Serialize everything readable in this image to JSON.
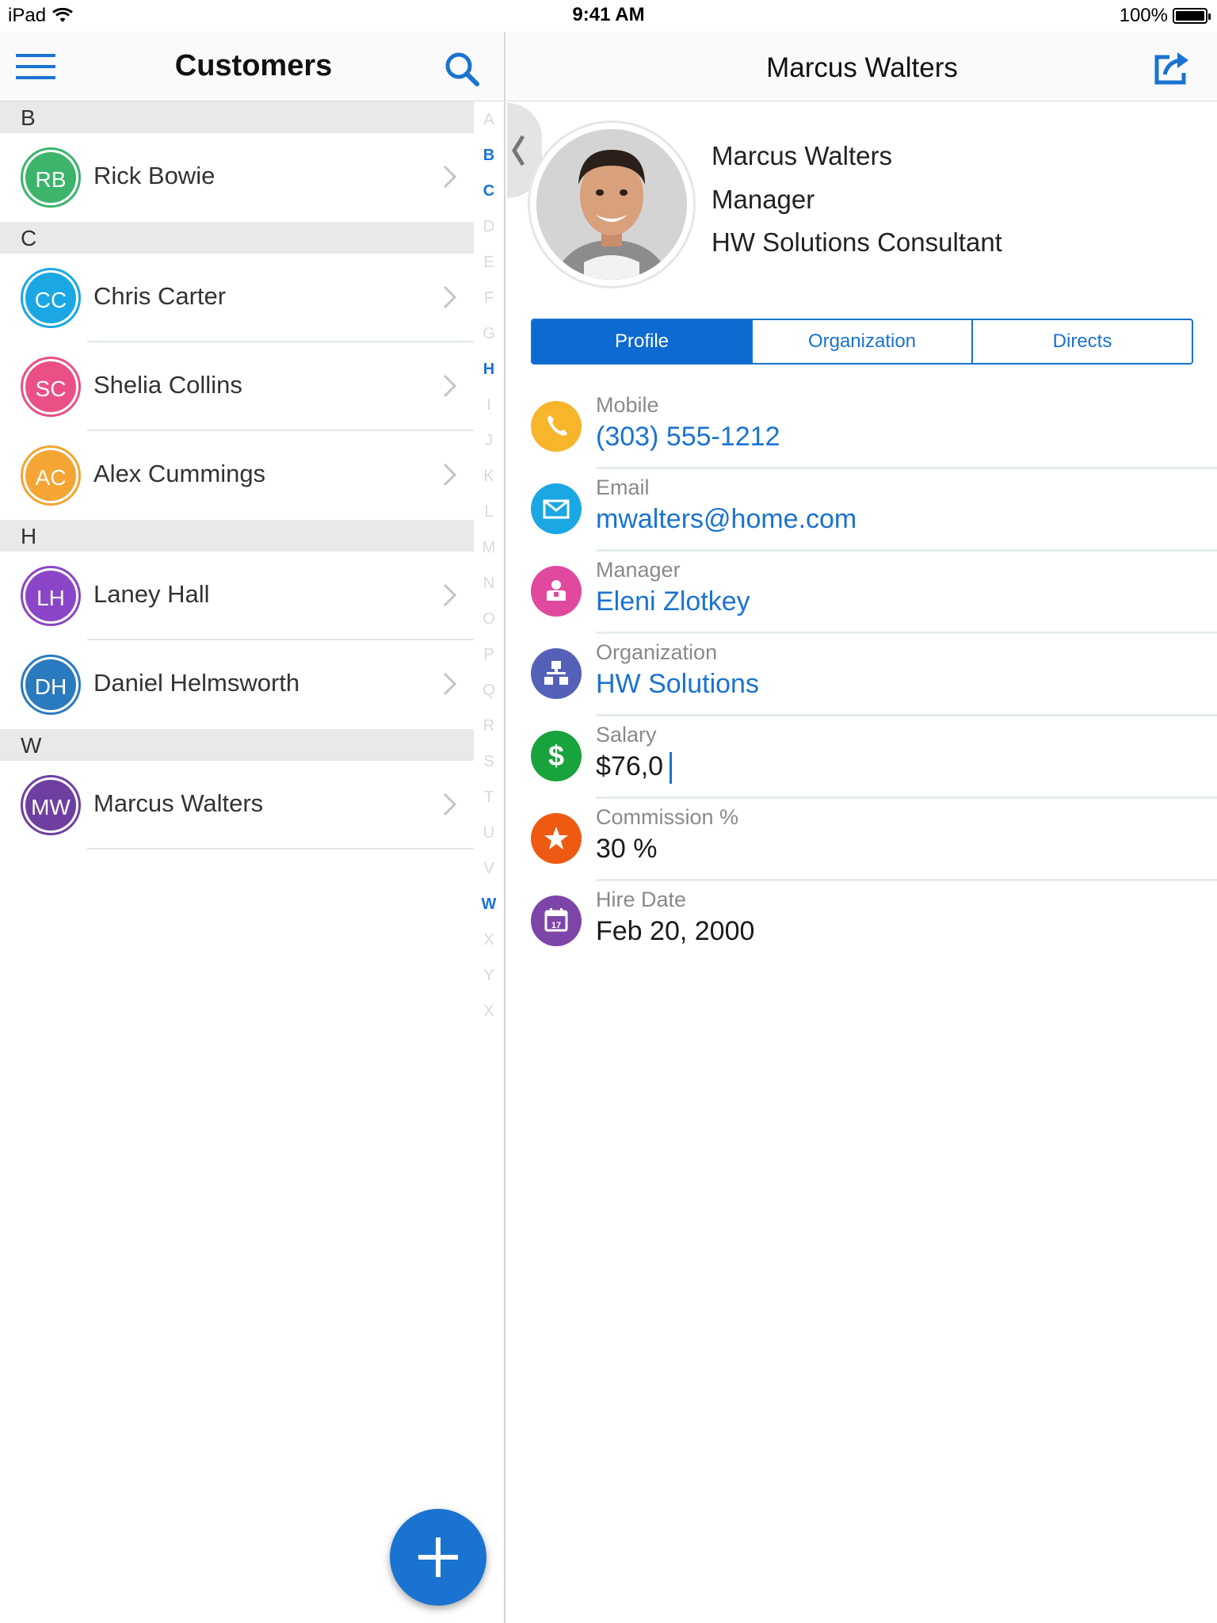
{
  "status_bar": {
    "device": "iPad",
    "time": "9:41 AM",
    "battery": "100%"
  },
  "left_pane": {
    "title": "Customers",
    "sections": [
      {
        "letter": "B",
        "people": [
          {
            "initials": "RB",
            "name": "Rick Bowie",
            "color": "#3cb46b"
          }
        ]
      },
      {
        "letter": "C",
        "people": [
          {
            "initials": "CC",
            "name": "Chris Carter",
            "color": "#1aa7e4"
          },
          {
            "initials": "SC",
            "name": "Shelia Collins",
            "color": "#ea4f86"
          },
          {
            "initials": "AC",
            "name": "Alex Cummings",
            "color": "#f4a533"
          }
        ]
      },
      {
        "letter": "H",
        "people": [
          {
            "initials": "LH",
            "name": "Laney Hall",
            "color": "#8b45c8"
          },
          {
            "initials": "DH",
            "name": "Daniel Helmsworth",
            "color": "#2a7ac0"
          }
        ]
      },
      {
        "letter": "W",
        "people": [
          {
            "initials": "MW",
            "name": "Marcus Walters",
            "color": "#6e3fa0"
          }
        ]
      }
    ],
    "index_letters": [
      "A",
      "B",
      "C",
      "D",
      "E",
      "F",
      "G",
      "H",
      "I",
      "J",
      "K",
      "L",
      "M",
      "N",
      "O",
      "P",
      "Q",
      "R",
      "S",
      "T",
      "U",
      "V",
      "W",
      "X",
      "Y",
      "X"
    ],
    "index_active": [
      "B",
      "C",
      "H",
      "W"
    ]
  },
  "right_pane": {
    "title": "Marcus Walters",
    "person": {
      "name": "Marcus Walters",
      "role": "Manager",
      "position": "HW Solutions Consultant"
    },
    "tabs": [
      "Profile",
      "Organization",
      "Directs"
    ],
    "active_tab": "Profile",
    "fields": [
      {
        "label": "Mobile",
        "value": "(303) 555-1212",
        "link": true,
        "icon": "phone-icon",
        "color": "#f7b52c"
      },
      {
        "label": "Email",
        "value": "mwalters@home.com",
        "link": true,
        "icon": "email-icon",
        "color": "#1aa7e4"
      },
      {
        "label": "Manager",
        "value": "Eleni Zlotkey",
        "link": true,
        "icon": "manager-icon",
        "color": "#e0499e"
      },
      {
        "label": "Organization",
        "value": "HW Solutions",
        "link": true,
        "icon": "organization-icon",
        "color": "#5560b8"
      },
      {
        "label": "Salary",
        "value": "$76,0",
        "link": false,
        "icon": "dollar-icon",
        "color": "#19a33c"
      },
      {
        "label": "Commission %",
        "value": "30 %",
        "link": false,
        "icon": "star-icon",
        "color": "#ef5a13"
      },
      {
        "label": "Hire Date",
        "value": "Feb 20, 2000",
        "link": false,
        "icon": "calendar-icon",
        "color": "#7d45a8",
        "calendar_day": "17"
      }
    ]
  },
  "colors": {
    "accent": "#1a73d1",
    "section_bg": "#e9e9e9"
  }
}
